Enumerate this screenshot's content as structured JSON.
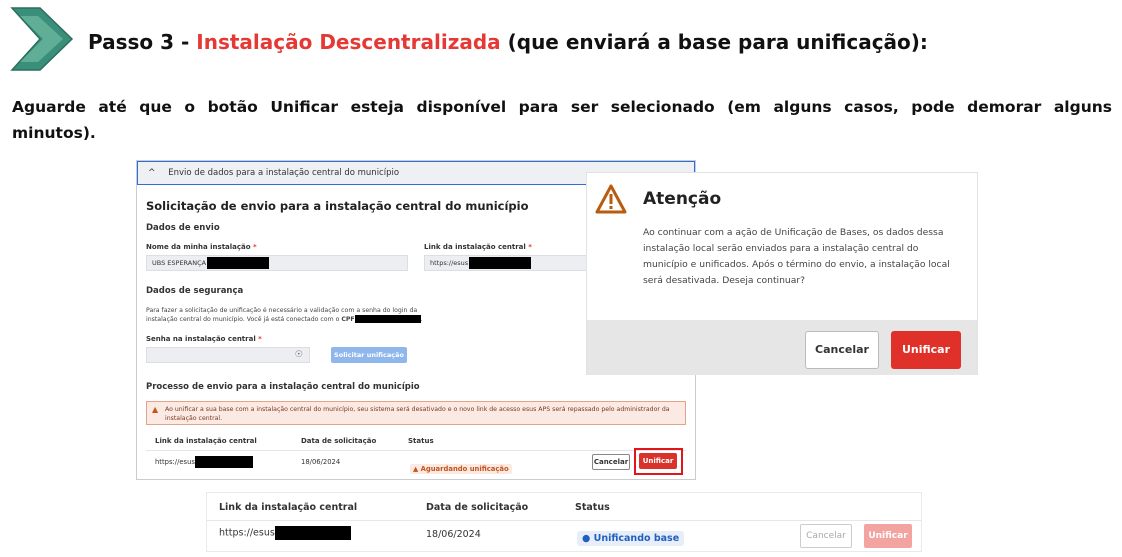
{
  "heading": {
    "step_prefix": "Passo 3 - ",
    "step_accent": "Instalação Descentralizada",
    "step_suffix": " (que enviará a base para unificação):"
  },
  "instruction": "Aguarde até que o botão Unificar esteja disponível para ser selecionado (em alguns casos, pode demorar alguns minutos).",
  "panel": {
    "accordion_title": "Envio de dados para a instalação central do município",
    "title": "Solicitação de envio para a instalação central do município",
    "dados_envio": "Dados de envio",
    "nome_label": "Nome da minha instalação",
    "nome_value": "UBS ESPERANÇA",
    "link_label": "Link da instalação central",
    "link_value": "https://esus",
    "seguranca": "Dados de segurança",
    "seguranca_text_1": "Para fazer a solicitação de unificação é necessário a validação com a senha do login da",
    "seguranca_text_2": "instalação central do município. Você já está conectado com o",
    "cpf_label": "CPF",
    "senha_label": "Senha na instalação central",
    "solicitar_button": "Solicitar unificação",
    "processo_title": "Processo de envio para a instalação central do município",
    "warning_line_1": "Ao unificar a sua base com a instalação central do município, seu sistema será desativado e o novo link de acesso esus APS será repassado pelo administrador da",
    "warning_line_2": "instalação central.",
    "table": {
      "headers": [
        "Link da instalação central",
        "Data de solicitação",
        "Status"
      ],
      "row": {
        "link": "https://esus",
        "date": "18/06/2024",
        "status": "Aguardando unificação"
      }
    },
    "cancel_button": "Cancelar",
    "unify_button": "Unificar"
  },
  "modal": {
    "title": "Atenção",
    "body": "Ao continuar com a ação de Unificação de Bases, os dados dessa instalação local serão enviados para a instalação central do município e unificados. Após o término do envio, a instalação local será desativada. Deseja continuar?",
    "cancel": "Cancelar",
    "unify": "Unificar"
  },
  "bottom_table": {
    "headers": [
      "Link da instalação central",
      "Data de solicitação",
      "Status"
    ],
    "row": {
      "link": "https://esus",
      "date": "18/06/2024",
      "status": "Unificando base"
    },
    "cancel": "Cancelar",
    "unify": "Unificar"
  },
  "colors": {
    "accent_red": "#e53935",
    "chevron_green": "#3a8f7b",
    "warning_orange": "#c2561b",
    "info_blue": "#1f5fbf"
  },
  "icons": [
    "chevron-arrow-icon",
    "caret-up-icon",
    "eye-icon",
    "warning-triangle-icon",
    "info-circle-icon"
  ]
}
